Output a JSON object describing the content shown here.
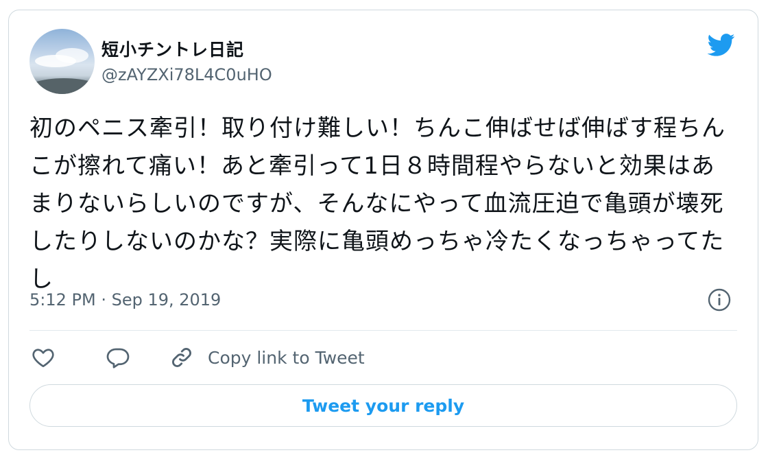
{
  "tweet": {
    "display_name": "短小チントレ日記",
    "handle": "@zAYZXi78L4C0uHO",
    "text": "初のペニス牽引！取り付け難しい！ちんこ伸ばせば伸ばす程ちんこが擦れて痛い！あと牽引って1日８時間程やらないと効果はあまりないらしいのですが、そんなにやって血流圧迫で亀頭が壊死したりしないのかな？実際に亀頭めっちゃ冷たくなっちゃってたし",
    "timestamp": "5:12 PM · Sep 19, 2019"
  },
  "actions": {
    "copy_link_label": "Copy link to Tweet",
    "reply_button_label": "Tweet your reply"
  },
  "icons": {
    "brand": "twitter-bird-icon",
    "info": "info-icon",
    "like": "heart-icon",
    "reply": "speech-bubble-icon",
    "copy": "link-icon"
  },
  "colors": {
    "accent": "#1d9bf0",
    "text": "#0f1419",
    "secondary": "#536471",
    "border": "#cfd9de"
  }
}
